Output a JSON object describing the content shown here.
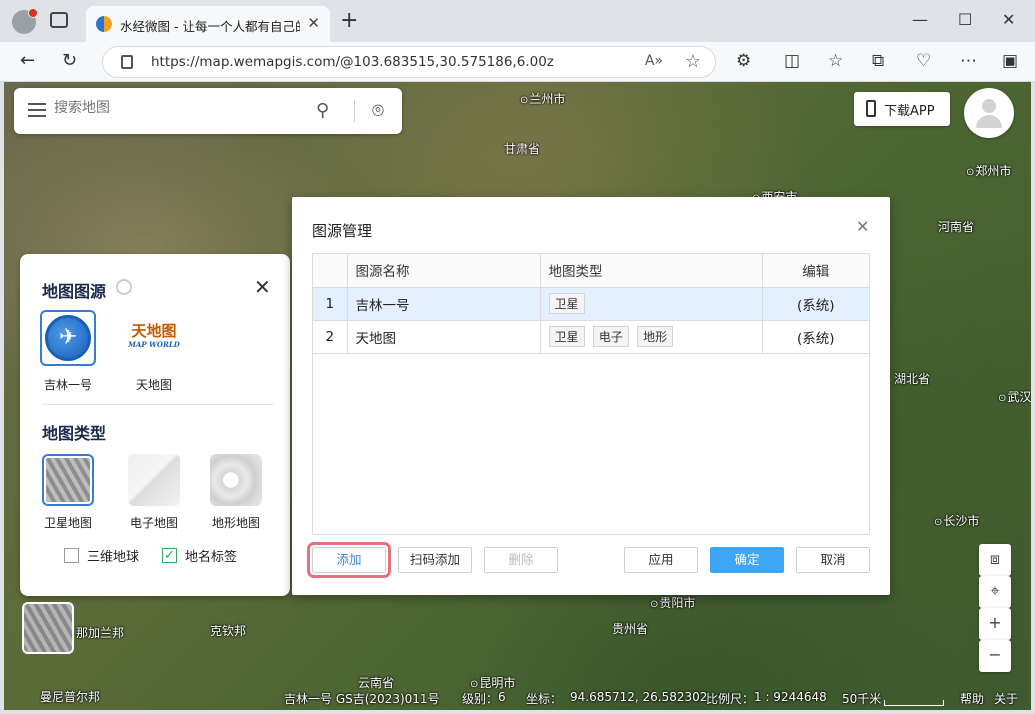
{
  "browser": {
    "tab_title": "水经微图 - 让每一个人都有自己的",
    "url": "https://map.wemapgis.com/@103.683515,30.575186,6.00z",
    "read_aloud": "A͓"
  },
  "search": {
    "placeholder": "搜索地图"
  },
  "download_app": "下载APP",
  "places": [
    {
      "name": "兰州市",
      "city": true
    },
    {
      "name": "甘肃省",
      "city": false
    },
    {
      "name": "郑州市",
      "city": true
    },
    {
      "name": "西安市",
      "city": true
    },
    {
      "name": "河南省",
      "city": false
    },
    {
      "name": "湖北省",
      "city": false
    },
    {
      "name": "武汉",
      "city": true
    },
    {
      "name": "长沙市",
      "city": true
    },
    {
      "name": "贵阳市",
      "city": true
    },
    {
      "name": "贵州省",
      "city": false
    },
    {
      "name": "云南省",
      "city": false
    },
    {
      "name": "昆明市",
      "city": true
    },
    {
      "name": "那加兰邦",
      "city": false
    },
    {
      "name": "克钦邦",
      "city": false
    },
    {
      "name": "曼尼普尔邦",
      "city": false
    }
  ],
  "source_panel": {
    "title": "地图图源",
    "sources": [
      {
        "label": "吉林一号",
        "icon": "jilin1-logo"
      },
      {
        "label": "天地图",
        "icon": "tianditu-logo",
        "logo_text": "天地图",
        "logo_sub": "MAP WORLD"
      }
    ],
    "type_title": "地图类型",
    "types": [
      {
        "label": "卫星地图"
      },
      {
        "label": "电子地图"
      },
      {
        "label": "地形地图"
      }
    ],
    "checkboxes": [
      {
        "label": "三维地球",
        "checked": false
      },
      {
        "label": "地名标签",
        "checked": true
      }
    ]
  },
  "dialog": {
    "title": "图源管理",
    "columns": [
      "图源名称",
      "地图类型",
      "编辑"
    ],
    "rows": [
      {
        "index": "1",
        "name": "吉林一号",
        "types": [
          "卫星"
        ],
        "edit": "(系统)"
      },
      {
        "index": "2",
        "name": "天地图",
        "types": [
          "卫星",
          "电子",
          "地形"
        ],
        "edit": "(系统)"
      }
    ],
    "buttons": {
      "add": "添加",
      "scan_add": "扫码添加",
      "delete": "删除",
      "apply": "应用",
      "ok": "确定",
      "cancel": "取消"
    }
  },
  "status": {
    "attribution": "吉林一号 GS吉(2023)011号",
    "level_label": "级别：",
    "level": "6",
    "coord_label": "坐标：",
    "coords": "94.685712, 26.582302",
    "scale_label": "比例尺：",
    "scale": "1 : 9244648",
    "scalebar": "50千米",
    "help": "帮助",
    "about": "关于"
  }
}
